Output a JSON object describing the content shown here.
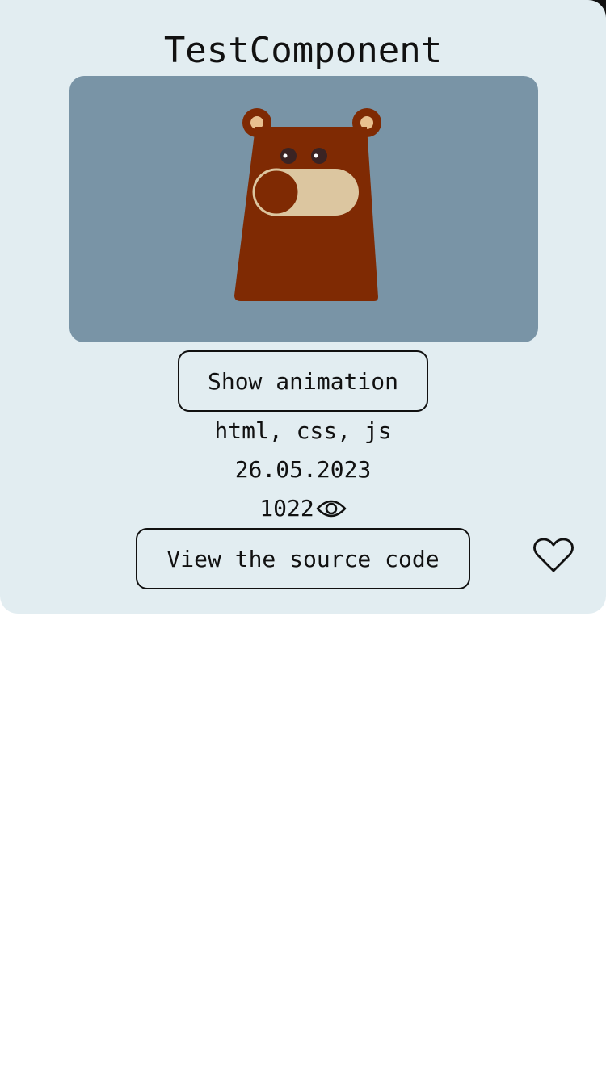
{
  "component": {
    "title": "TestComponent",
    "show_animation_label": "Show animation",
    "tags": "html, css, js",
    "date": "26.05.2023",
    "views": "1022",
    "view_source_label": "View the source code"
  },
  "icons": {
    "views": "eye-icon",
    "favorite": "heart-icon"
  },
  "colors": {
    "card_background": "#e2edf1",
    "preview_background": "#7994a6",
    "bear_body": "#7f2a03",
    "bear_muzzle": "#dcc6a0",
    "bear_ear_inner": "#e8c08f",
    "bear_eye": "#3a2323",
    "text": "#111111"
  }
}
